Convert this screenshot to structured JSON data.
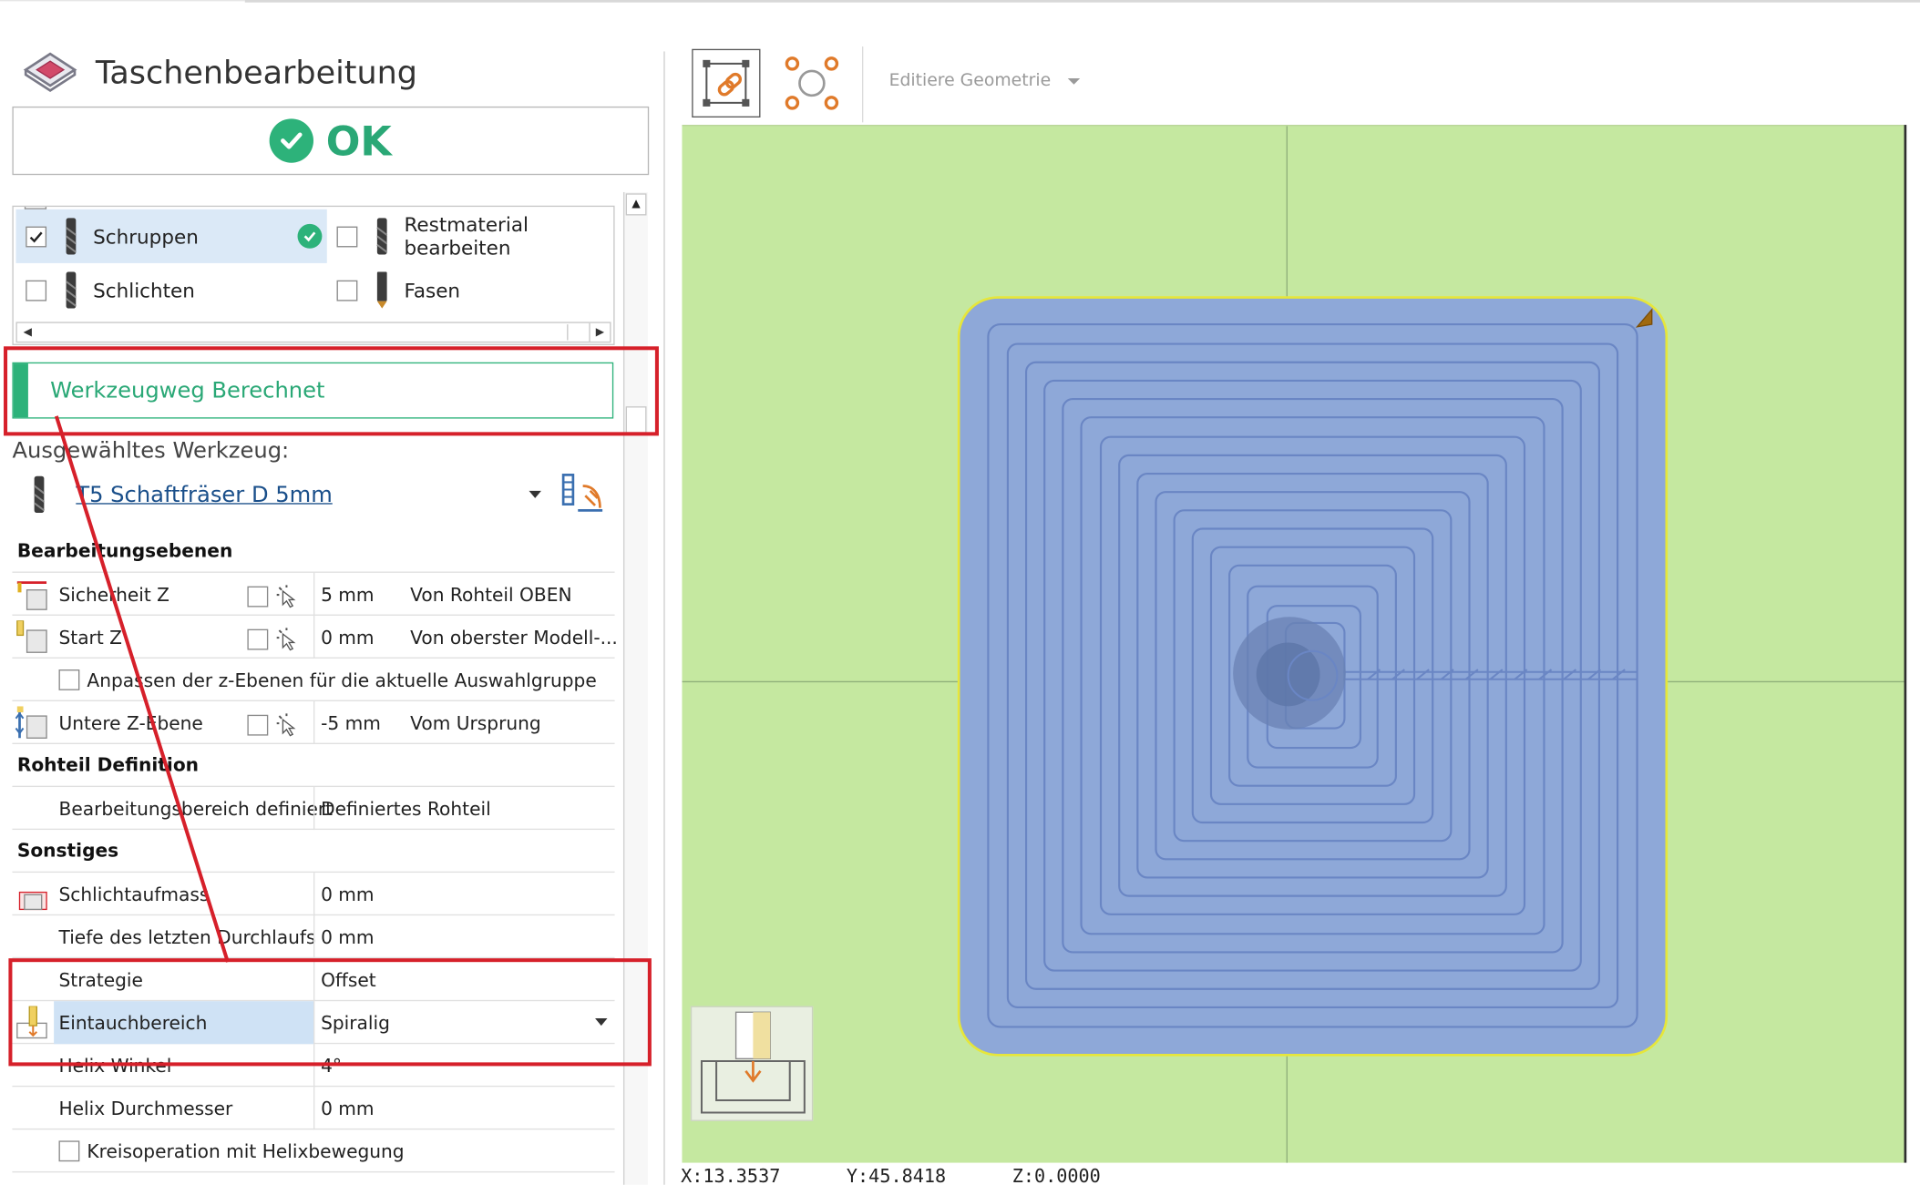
{
  "title": "Taschenbearbeitung",
  "ok_label": "OK",
  "operations": [
    {
      "label": "Schruppen",
      "checked": true,
      "selected": true,
      "computed": true
    },
    {
      "label": "Restmaterial bearbeiten",
      "checked": false
    },
    {
      "label": "Schlichten",
      "checked": false
    },
    {
      "label": "Fasen",
      "checked": false
    }
  ],
  "status": {
    "text": "Werkzeugweg Berechnet",
    "color": "#2aa876"
  },
  "tool": {
    "section_label": "Ausgewähltes Werkzeug:",
    "name": "T5 Schaftfräser D 5mm"
  },
  "sections": {
    "planes": "Bearbeitungsebenen",
    "stock": "Rohteil Definition",
    "misc": "Sonstiges"
  },
  "rows": {
    "safety_z": {
      "label": "Sicherheit Z",
      "value": "5 mm",
      "ref": "Von Rohteil OBEN"
    },
    "start_z": {
      "label": "Start Z",
      "value": "0 mm",
      "ref": "Von oberster Modell-..."
    },
    "adjust_z": {
      "label": "Anpassen der z-Ebenen für die aktuelle Auswahlgruppe"
    },
    "lower_z": {
      "label": "Untere Z-Ebene",
      "value": "-5 mm",
      "ref": "Vom Ursprung"
    },
    "area_defined": {
      "label": "Bearbeitungsbereich definiert",
      "value": "Definiertes Rohteil"
    },
    "finish_allowance": {
      "label": "Schlichtaufmass",
      "value": "0 mm"
    },
    "last_pass_depth": {
      "label": "Tiefe des letzten Durchlaufs",
      "value": "0 mm"
    },
    "strategy": {
      "label": "Strategie",
      "value": "Offset"
    },
    "plunge": {
      "label": "Eintauchbereich",
      "value": "Spiralig"
    },
    "helix_angle": {
      "label": "Helix Winkel",
      "value": "4°"
    },
    "helix_diameter": {
      "label": "Helix Durchmesser",
      "value": "0 mm"
    },
    "circle_op": {
      "label": "Kreisoperation mit Helixbewegung"
    }
  },
  "toolbar": {
    "edit_geometry": "Editiere Geometrie"
  },
  "coords": {
    "x": "X:13.3537",
    "y": "Y:45.8418",
    "z": "Z:0.0000"
  },
  "colors": {
    "accent_green": "#2db27a",
    "highlight_red": "#d6202a",
    "viewport_bg": "#c5e8a0",
    "pocket_fill": "#8ea8d8",
    "toolpath": "#6a86c4"
  }
}
